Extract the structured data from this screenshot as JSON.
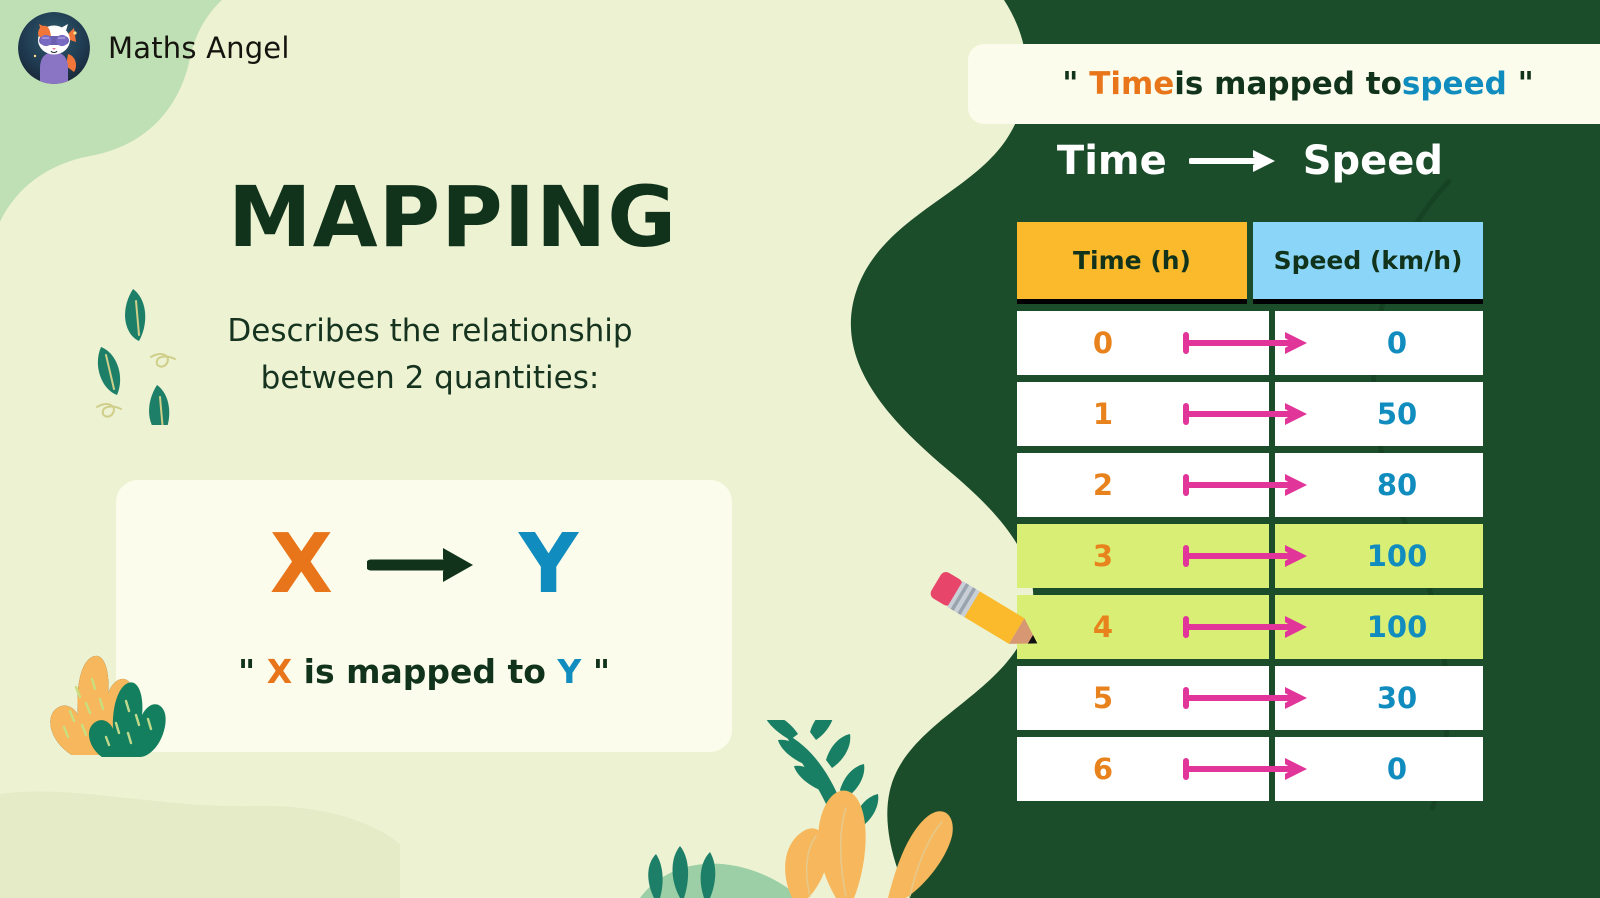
{
  "brand": {
    "name": "Maths Angel",
    "logo_icon": "cat-mascot-icon"
  },
  "left": {
    "title": "MAPPING",
    "subtitle_line1": "Describes the relationship",
    "subtitle_line2": "between 2 quantities:",
    "formula": {
      "input": "X",
      "arrow_icon": "right-arrow-icon",
      "output": "Y"
    },
    "quote": {
      "open_mark": "\"",
      "input": "X",
      "middle": " is mapped to ",
      "output": "Y",
      "close_mark": "\""
    }
  },
  "right": {
    "banner": {
      "open_mark": "\"",
      "input": "Time",
      "middle": " is mapped to ",
      "output": "speed",
      "close_mark": "\""
    },
    "map_header": {
      "input": "Time",
      "arrow_icon": "right-arrow-icon",
      "output": "Speed"
    }
  },
  "colors": {
    "background_cream": "#EDF2D2",
    "panel_dark_green": "#1B4D2B",
    "card_ivory": "#FBFCEB",
    "accent_orange": "#E8751A",
    "accent_blue": "#118CBF",
    "header_amber": "#FBBA2B",
    "header_sky": "#8BD6F8",
    "highlight_lime": "#D9EE74",
    "arrow_pink": "#E1359A",
    "text_dark_green": "#11331C"
  },
  "chart_data": {
    "type": "table",
    "title": "Time → Speed",
    "columns": [
      "Time (h)",
      "Speed (km/h)"
    ],
    "x": [
      0,
      1,
      2,
      3,
      4,
      5,
      6
    ],
    "values": [
      0,
      50,
      80,
      100,
      100,
      30,
      0
    ],
    "rows": [
      {
        "time": "0",
        "speed": "0",
        "highlighted": false,
        "arrow_icon": "map-arrow-icon"
      },
      {
        "time": "1",
        "speed": "50",
        "highlighted": false,
        "arrow_icon": "map-arrow-icon"
      },
      {
        "time": "2",
        "speed": "80",
        "highlighted": false,
        "arrow_icon": "map-arrow-icon"
      },
      {
        "time": "3",
        "speed": "100",
        "highlighted": true,
        "arrow_icon": "map-arrow-icon"
      },
      {
        "time": "4",
        "speed": "100",
        "highlighted": true,
        "arrow_icon": "map-arrow-icon"
      },
      {
        "time": "5",
        "speed": "30",
        "highlighted": false,
        "arrow_icon": "map-arrow-icon"
      },
      {
        "time": "6",
        "speed": "0",
        "highlighted": false,
        "arrow_icon": "map-arrow-icon"
      }
    ],
    "xlabel": "Time (h)",
    "ylabel": "Speed (km/h)"
  },
  "decorations": {
    "leaves_icon": "leaves-icon",
    "bush_icon": "bush-icon",
    "foliage_icon": "foliage-icon",
    "pencil_icon": "pencil-icon"
  }
}
